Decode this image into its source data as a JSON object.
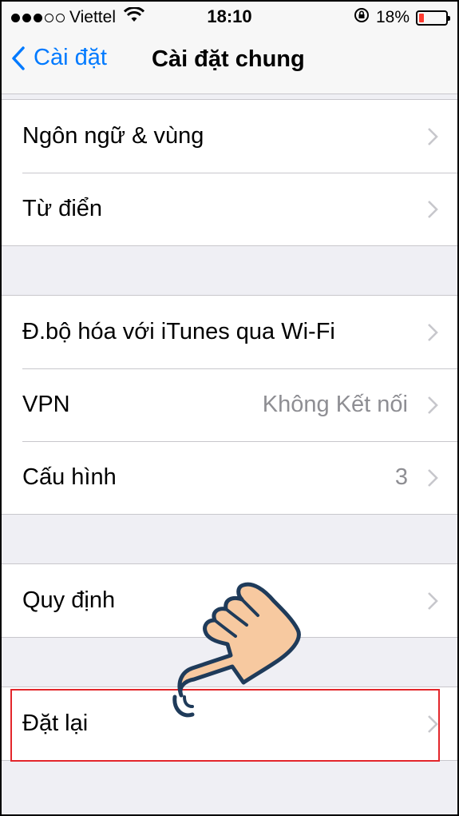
{
  "status_bar": {
    "carrier": "Viettel",
    "signal_bars_filled": 3,
    "signal_bars_total": 5,
    "time": "18:10",
    "battery_percent": "18%",
    "battery_level": 0.18
  },
  "nav": {
    "back_label": "Cài đặt",
    "title": "Cài đặt chung"
  },
  "groups": [
    {
      "rows": [
        {
          "label": "Ngôn ngữ & vùng"
        },
        {
          "label": "Từ điển"
        }
      ]
    },
    {
      "rows": [
        {
          "label": "Đ.bộ hóa với iTunes qua Wi-Fi"
        },
        {
          "label": "VPN",
          "value": "Không Kết nối"
        },
        {
          "label": "Cấu hình",
          "value": "3"
        }
      ]
    },
    {
      "rows": [
        {
          "label": "Quy định"
        }
      ]
    },
    {
      "rows": [
        {
          "label": "Đặt lại",
          "highlighted": true
        }
      ]
    }
  ],
  "colors": {
    "accent": "#007aff",
    "highlight_border": "#e3262b",
    "hand_fill": "#f7c9a0",
    "hand_outline": "#1f3b5a",
    "battery_low": "#ff3b30"
  },
  "icons": [
    "chevron-left-icon",
    "wifi-icon",
    "orientation-lock-icon",
    "battery-icon",
    "chevron-right-icon",
    "pointing-hand-icon"
  ]
}
